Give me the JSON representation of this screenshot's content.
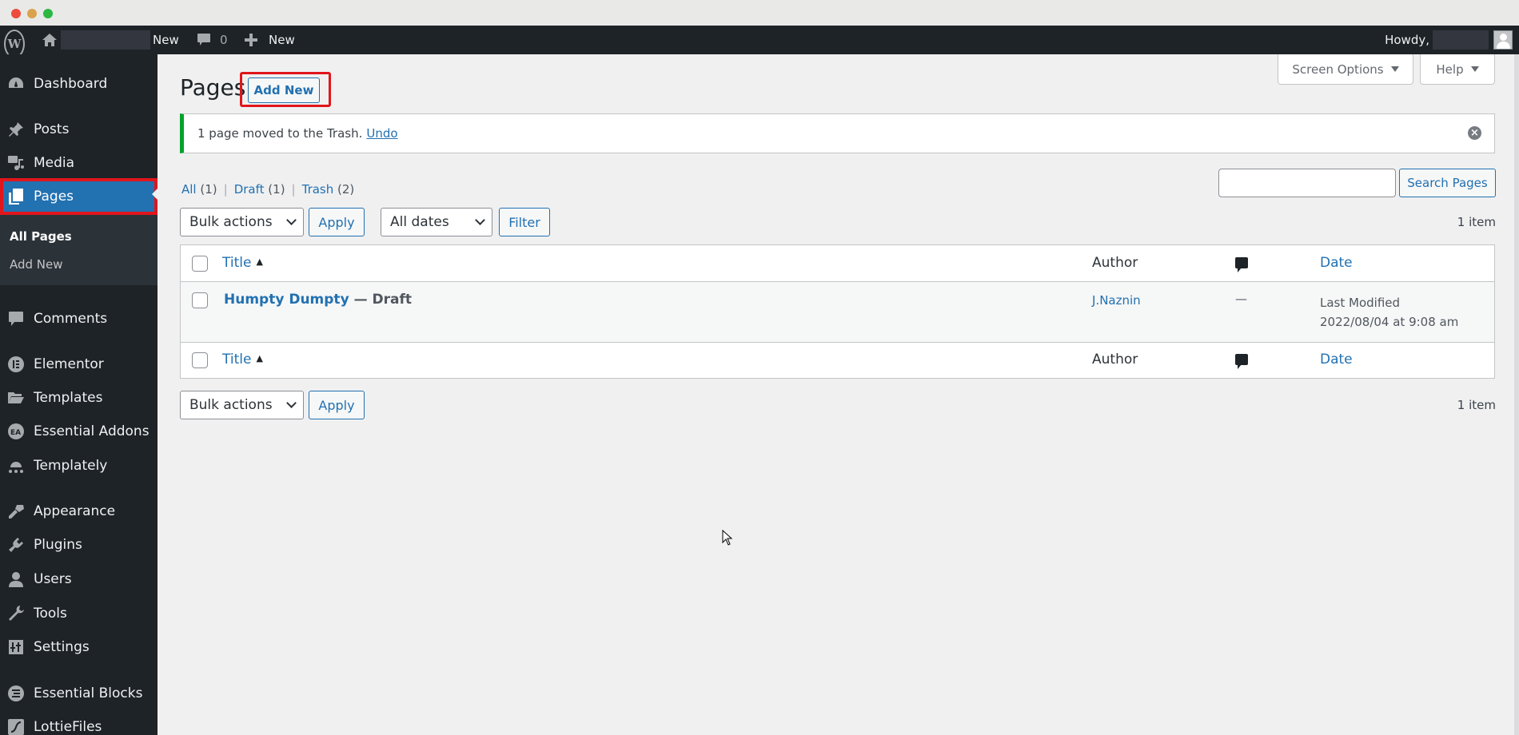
{
  "window": {
    "controls": [
      "close",
      "minimize",
      "maximize"
    ]
  },
  "admin_bar": {
    "wp_logo": "W",
    "site_new_label": "New",
    "comments_count": "0",
    "new_label": "New",
    "howdy_label": "Howdy,"
  },
  "sidebar": {
    "items": [
      {
        "label": "Dashboard",
        "icon": "dashboard-icon"
      },
      {
        "label": "Posts",
        "icon": "pin-icon"
      },
      {
        "label": "Media",
        "icon": "media-icon"
      },
      {
        "label": "Pages",
        "icon": "pages-icon",
        "current": true
      },
      {
        "label": "Comments",
        "icon": "comment-icon"
      },
      {
        "label": "Elementor",
        "icon": "elementor-icon"
      },
      {
        "label": "Templates",
        "icon": "folder-icon"
      },
      {
        "label": "Essential Addons",
        "icon": "essential-addons-icon"
      },
      {
        "label": "Templately",
        "icon": "templately-icon"
      },
      {
        "label": "Appearance",
        "icon": "paintbrush-icon"
      },
      {
        "label": "Plugins",
        "icon": "plugin-icon"
      },
      {
        "label": "Users",
        "icon": "user-icon"
      },
      {
        "label": "Tools",
        "icon": "wrench-icon"
      },
      {
        "label": "Settings",
        "icon": "settings-icon"
      },
      {
        "label": "Essential Blocks",
        "icon": "essential-blocks-icon"
      },
      {
        "label": "LottieFiles",
        "icon": "lottiefiles-icon"
      }
    ],
    "submenu": [
      {
        "label": "All Pages",
        "current": true
      },
      {
        "label": "Add New"
      }
    ]
  },
  "screen_meta": {
    "screen_options_label": "Screen Options",
    "help_label": "Help"
  },
  "page": {
    "title": "Pages",
    "add_new_label": "Add New"
  },
  "notice": {
    "message": "1 page moved to the Trash.",
    "undo_label": "Undo",
    "dismiss_symbol": "×",
    "accent_color": "#00a32a"
  },
  "filters": {
    "views": [
      {
        "label": "All",
        "count": "(1)"
      },
      {
        "label": "Draft",
        "count": "(1)"
      },
      {
        "label": "Trash",
        "count": "(2)"
      }
    ],
    "separator": "|",
    "bulk_actions_selected": "Bulk actions",
    "apply_label": "Apply",
    "dates_selected": "All dates",
    "filter_label": "Filter",
    "search_value": "",
    "search_button_label": "Search Pages",
    "items_count": "1 item"
  },
  "table": {
    "columns": {
      "title": "Title",
      "sort_indicator": "▲",
      "author": "Author",
      "comments_icon": "comment-bubble-icon",
      "date": "Date"
    },
    "rows": [
      {
        "title": "Humpty Dumpty",
        "state": " — Draft",
        "author": "J.Naznin",
        "comments": "—",
        "date_label": "Last Modified",
        "date_value": "2022/08/04 at 9:08 am"
      }
    ]
  },
  "bottom_nav": {
    "bulk_actions_selected": "Bulk actions",
    "apply_label": "Apply",
    "items_count": "1 item"
  },
  "colors": {
    "admin_bar_bg": "#1d2327",
    "accent_blue": "#2271b1",
    "highlight_red": "#e0161c",
    "main_bg": "#f0f0f1"
  }
}
